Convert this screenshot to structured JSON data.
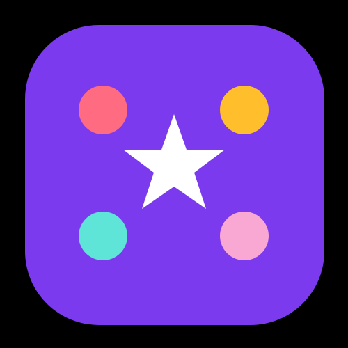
{
  "app_icon": {
    "name": "star-dots-app-icon",
    "colors": {
      "page_background": "#000000",
      "tile_background": "#7B3AED",
      "star": "#FFFFFF"
    },
    "center_glyph": "star-icon",
    "dots": [
      {
        "name": "dot-top-left",
        "color": "#FF6B81"
      },
      {
        "name": "dot-top-right",
        "color": "#FFBE2B"
      },
      {
        "name": "dot-bottom-left",
        "color": "#5FE5D8"
      },
      {
        "name": "dot-bottom-right",
        "color": "#F9A8D4"
      }
    ]
  }
}
